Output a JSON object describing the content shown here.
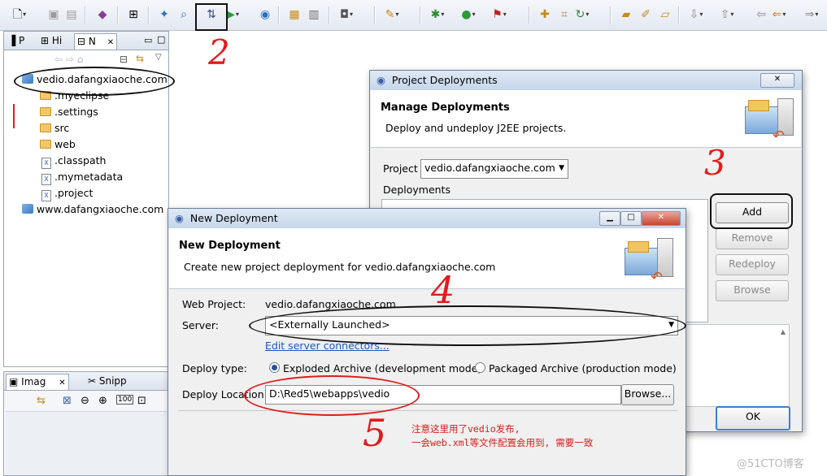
{
  "left_panel": {
    "tabs": [
      "P",
      "Hi",
      "N"
    ],
    "tree": [
      {
        "label": "vedio.dafangxiaoche.com",
        "icon": "project-icon"
      },
      {
        "label": ".myeclipse",
        "icon": "folder-icon"
      },
      {
        "label": ".settings",
        "icon": "folder-icon"
      },
      {
        "label": "src",
        "icon": "folder-icon"
      },
      {
        "label": "web",
        "icon": "folder-icon"
      },
      {
        "label": ".classpath",
        "icon": "xml-file-icon"
      },
      {
        "label": ".mymetadata",
        "icon": "xml-file-icon"
      },
      {
        "label": ".project",
        "icon": "xml-file-icon"
      },
      {
        "label": "www.dafangxiaoche.com",
        "icon": "project-icon"
      }
    ]
  },
  "bottom_panel": {
    "tabs": [
      "Imag",
      "Snipp"
    ]
  },
  "project_deployments": {
    "title": "Project Deployments",
    "header_title": "Manage Deployments",
    "header_desc": "Deploy and undeploy J2EE projects.",
    "project_label": "Project",
    "project_value": "vedio.dafangxiaoche.com",
    "deployments_label": "Deployments",
    "buttons": {
      "add": "Add",
      "remove": "Remove",
      "redeploy": "Redeploy",
      "browse": "Browse",
      "ok": "OK"
    }
  },
  "new_deployment": {
    "title": "New Deployment",
    "header_title": "New Deployment",
    "header_desc": "Create new project deployment for vedio.dafangxiaoche.com",
    "web_project_label": "Web Project:",
    "web_project_value": "vedio.dafangxiaoche.com",
    "server_label": "Server:",
    "server_value": "<Externally Launched>",
    "edit_link": "Edit server connectors...",
    "deploy_type_label": "Deploy type:",
    "exploded": "Exploded Archive (development mode)",
    "packaged": "Packaged Archive (production mode)",
    "deploy_location_label": "Deploy Location:",
    "deploy_location_value": "D:\\Red5\\webapps\\vedio",
    "browse": "Browse..."
  },
  "annotations": {
    "marks": [
      "2",
      "3",
      "4",
      "5"
    ],
    "note_line1": "注意这里用了vedio发布,",
    "note_line2": "一会web.xml等文件配置会用到, 需要一致"
  },
  "watermark": "@51CTO博客"
}
